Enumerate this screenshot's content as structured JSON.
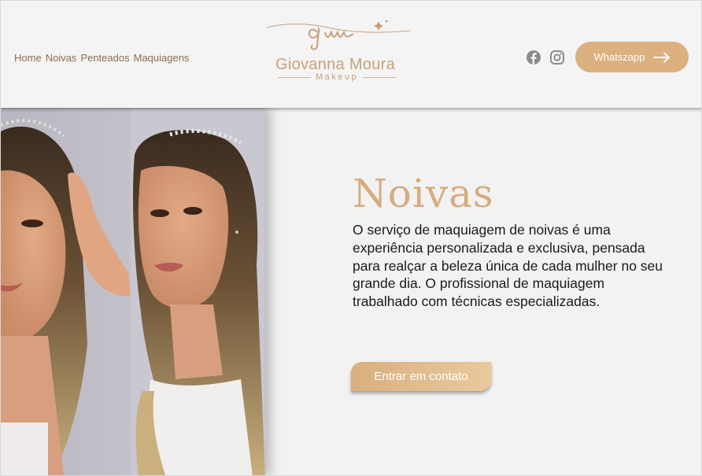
{
  "nav": {
    "items": [
      {
        "label": "Home"
      },
      {
        "label": "Noivas"
      },
      {
        "label": "Penteados"
      },
      {
        "label": "Maquiagens"
      }
    ]
  },
  "logo": {
    "name": "Giovanna Moura",
    "sub": "Makeup",
    "monogram": "gm"
  },
  "social": {
    "facebook_icon": "facebook-icon",
    "instagram_icon": "instagram-icon"
  },
  "header": {
    "whatsapp_label": "Whatszapp",
    "arrow_icon": "arrow-right-icon"
  },
  "hero": {
    "title": "Noivas",
    "description": "O serviço de maquiagem de noivas é uma experiência personalizada e exclusiva, pensada para realçar a beleza única de cada mulher no seu grande dia. O profissional de maquiagem trabalhado com técnicas especializadas.",
    "cta_label": "Entrar em contato"
  },
  "colors": {
    "accent": "#dcb07f",
    "title": "#d6ad80",
    "nav": "#8a6f52",
    "background": "#f3f3f3"
  }
}
